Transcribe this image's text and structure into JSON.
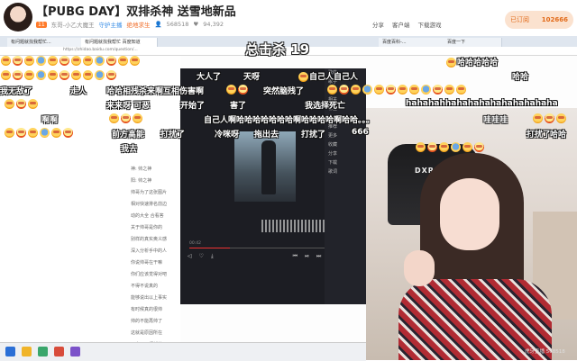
{
  "header": {
    "title": "【PUBG DAY】双排杀神 送雪地新品",
    "level_badge": "11",
    "streamer": "东哥-小乙大魔王",
    "guard_label": "守护主播",
    "hot_label": "绝地求生",
    "viewer_count": "568518",
    "fans_count": "94,392",
    "tools": [
      "分享",
      "客户端",
      "下载游戏"
    ],
    "follow_label": "已订阅",
    "follow_count": "102666"
  },
  "browser": {
    "tabs": [
      "有问题就找我帮忙...",
      "有问题就找我帮忙 百度知道",
      "百度百科-...",
      "百度一下"
    ],
    "address": "https://zhidao.baidu.com/question/..."
  },
  "wiki_items": [
    "神: 帅之神",
    "阳: 帅之神",
    "帅哥为了这张图片",
    "相对快速排名前边",
    "动的大全 合看答",
    "关于帅哥是你的",
    "别样的真实奥义感",
    "深入分析手中的人",
    "你说帅哥在干嘛",
    "你们应该觉得对吧",
    "不得不说真的",
    "能够说出以上事实",
    "有时候真的很帅",
    "帅的不能再帅了",
    "这就是原因所在",
    "无人可以超越他"
  ],
  "player": {
    "side_items": [
      "歌曲",
      "歌手",
      "专辑",
      "相关",
      "标签",
      "评论",
      "推荐",
      "更多",
      "收藏",
      "分享",
      "下载",
      "歌词"
    ],
    "time": "00:42",
    "controls": [
      "◁",
      "♡",
      "⤓",
      "⏮",
      "⏯",
      "⏭",
      "≡"
    ]
  },
  "combo": "总击杀 19",
  "danmaku": [
    {
      "text": "大人了",
      "emo": "none"
    },
    {
      "text": "天呀",
      "emo": "none"
    },
    {
      "text": "自己人",
      "emo": "left"
    },
    {
      "text": "自己人",
      "emo": "none"
    },
    {
      "text": "哈哈哈哈哈",
      "emo": "left"
    },
    {
      "text": "哈哈",
      "emo": "none"
    },
    {
      "text": "我无敌了",
      "emo": "none"
    },
    {
      "text": "走人",
      "emo": "none"
    },
    {
      "text": "哈哈相残杀来啊互相伤害啊",
      "emo": "none"
    },
    {
      "text": "突然脑残了",
      "emo": "none"
    },
    {
      "text": "来来呀 可恶",
      "emo": "none"
    },
    {
      "text": "开始了",
      "emo": "none"
    },
    {
      "text": "害了",
      "emo": "none"
    },
    {
      "text": "我选择死亡",
      "emo": "none"
    },
    {
      "text": "hahahahhahahahahahahahahaha",
      "emo": "none"
    },
    {
      "text": "啊啊",
      "emo": "none"
    },
    {
      "text": "自己人啊哈哈哈哈哈哈哈啊哈哈哈哈啊哈哈。。。",
      "emo": "none"
    },
    {
      "text": "哇哇哇",
      "emo": "none"
    },
    {
      "text": "前方高能",
      "emo": "none"
    },
    {
      "text": "打扰了",
      "emo": "none"
    },
    {
      "text": "冷咪呀",
      "emo": "none"
    },
    {
      "text": "拖出去",
      "emo": "none"
    },
    {
      "text": "打扰了",
      "emo": "none"
    },
    {
      "text": "666",
      "emo": "none"
    },
    {
      "text": "打扰了",
      "emo": "none"
    },
    {
      "text": "哈哈",
      "emo": "none"
    },
    {
      "text": "我去",
      "emo": "none"
    },
    {
      "text": "啊啊啊啊",
      "emo": "none"
    }
  ],
  "cam": {
    "chair_logo": "DXRACER",
    "watermark": "虎牙直播 568518"
  }
}
